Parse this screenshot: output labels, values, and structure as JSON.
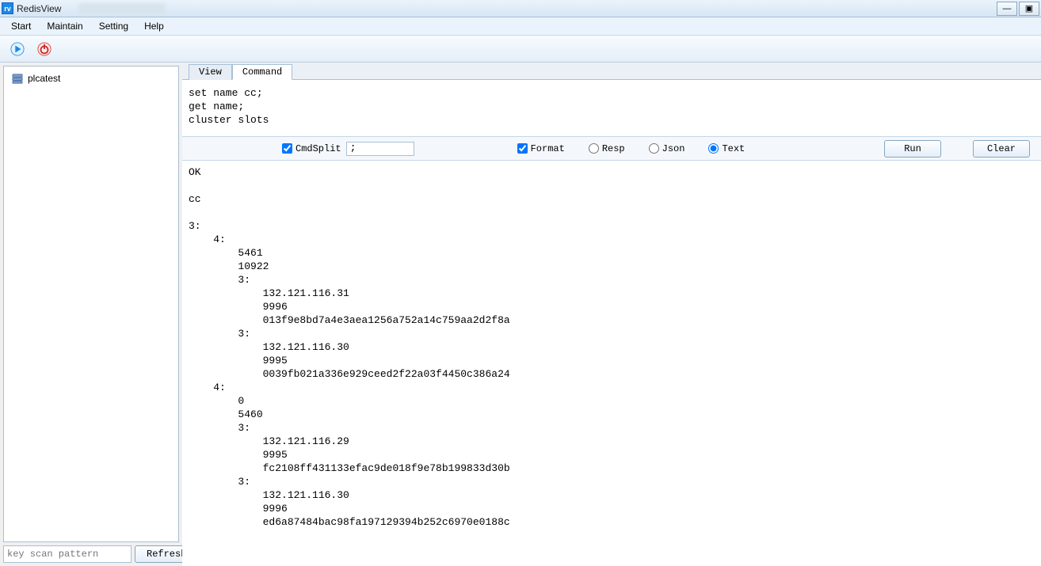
{
  "titlebar": {
    "app_icon_text": "rv",
    "title": "RedisView"
  },
  "menu": {
    "items": [
      "Start",
      "Maintain",
      "Setting",
      "Help"
    ]
  },
  "sidebar": {
    "tree": {
      "items": [
        {
          "label": "plcatest"
        }
      ]
    },
    "key_pattern_placeholder": "key scan pattern",
    "refresh_label": "Refresh"
  },
  "tabs": {
    "items": [
      {
        "label": "View",
        "active": false
      },
      {
        "label": "Command",
        "active": true
      }
    ]
  },
  "command": {
    "input_text": "set name cc;\nget name;\ncluster slots",
    "cmd_split_label": "CmdSplit",
    "cmd_split_checked": true,
    "cmd_split_value": ";",
    "format_label": "Format",
    "format_checked": true,
    "radio_options": {
      "resp": "Resp",
      "json": "Json",
      "text": "Text",
      "selected": "text"
    },
    "run_label": "Run",
    "clear_label": "Clear"
  },
  "output": {
    "text": "OK\n\ncc\n\n3:\n    4:\n        5461\n        10922\n        3:\n            132.121.116.31\n            9996\n            013f9e8bd7a4e3aea1256a752a14c759aa2d2f8a\n        3:\n            132.121.116.30\n            9995\n            0039fb021a336e929ceed2f22a03f4450c386a24\n    4:\n        0\n        5460\n        3:\n            132.121.116.29\n            9995\n            fc2108ff431133efac9de018f9e78b199833d30b\n        3:\n            132.121.116.30\n            9996\n            ed6a87484bac98fa197129394b252c6970e0188c"
  }
}
